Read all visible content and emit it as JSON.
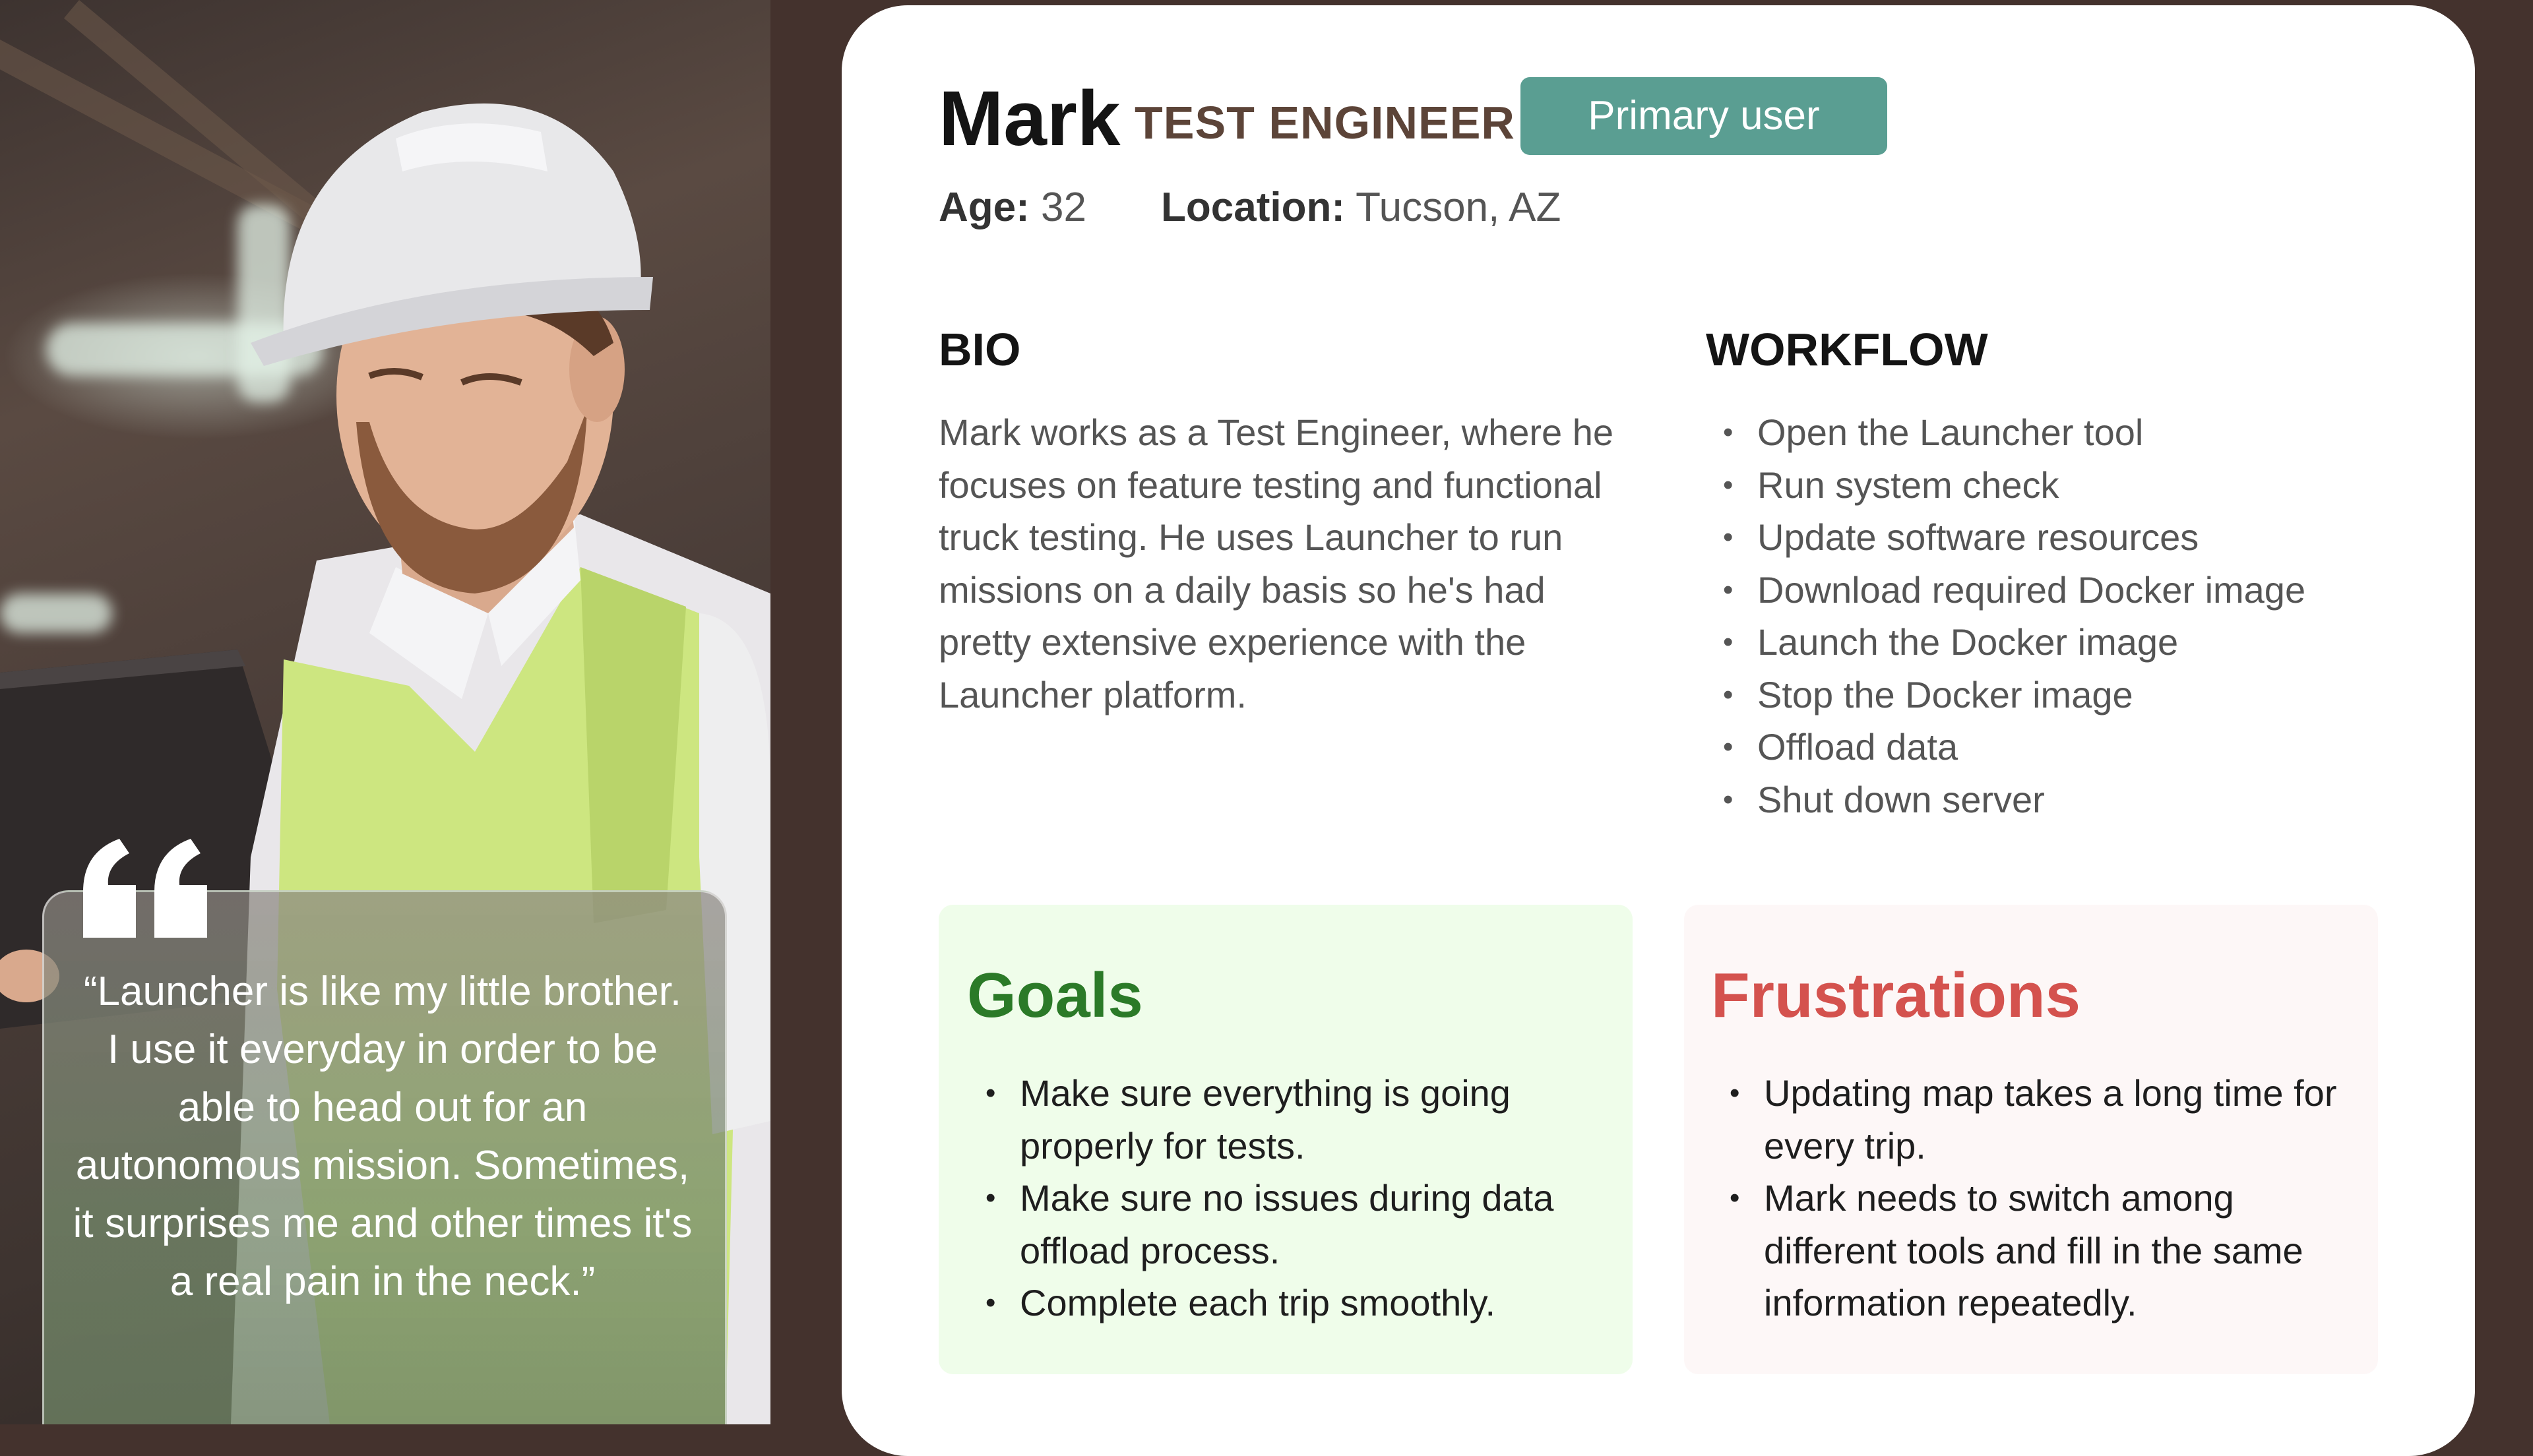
{
  "persona": {
    "name": "Mark",
    "role": "TEST ENGINEER",
    "badge": "Primary user",
    "age_label": "Age:",
    "age_value": "32",
    "location_label": "Location:",
    "location_value": "Tucson, AZ"
  },
  "quote": {
    "icon": "quote-icon",
    "text": "“Launcher is like my little brother. I use it everyday in order to be able to head out for an autonomous mission. Sometimes, it surprises me and other times it's a real pain in the neck.”"
  },
  "bio": {
    "heading": "BIO",
    "text": "Mark works as a Test Engineer, where he focuses on feature testing and functional truck testing. He uses Launcher to run missions on a daily basis so he's had pretty extensive experience with the Launcher platform."
  },
  "workflow": {
    "heading": "WORKFLOW",
    "steps": [
      "Open the Launcher tool",
      "Run system check",
      "Update software resources",
      "Download required Docker image",
      "Launch the Docker image",
      "Stop the Docker image",
      "Offload data",
      "Shut down server"
    ]
  },
  "goals": {
    "title": "Goals",
    "items": [
      "Make sure everything is going properly for tests.",
      "Make sure no issues during data offload process.",
      "Complete each trip smoothly."
    ]
  },
  "frustrations": {
    "title": "Frustrations",
    "items": [
      "Updating map takes a long time for every trip.",
      "Mark needs to switch among different tools and fill in the same information repeatedly."
    ]
  },
  "colors": {
    "background": "#44322d",
    "badge": "#5a9e92",
    "goals_title": "#2b7a28",
    "goals_bg": "#effdea",
    "frustrations_title": "#d4524e",
    "frustrations_bg": "#fdf7f7",
    "role": "#5c4438"
  }
}
